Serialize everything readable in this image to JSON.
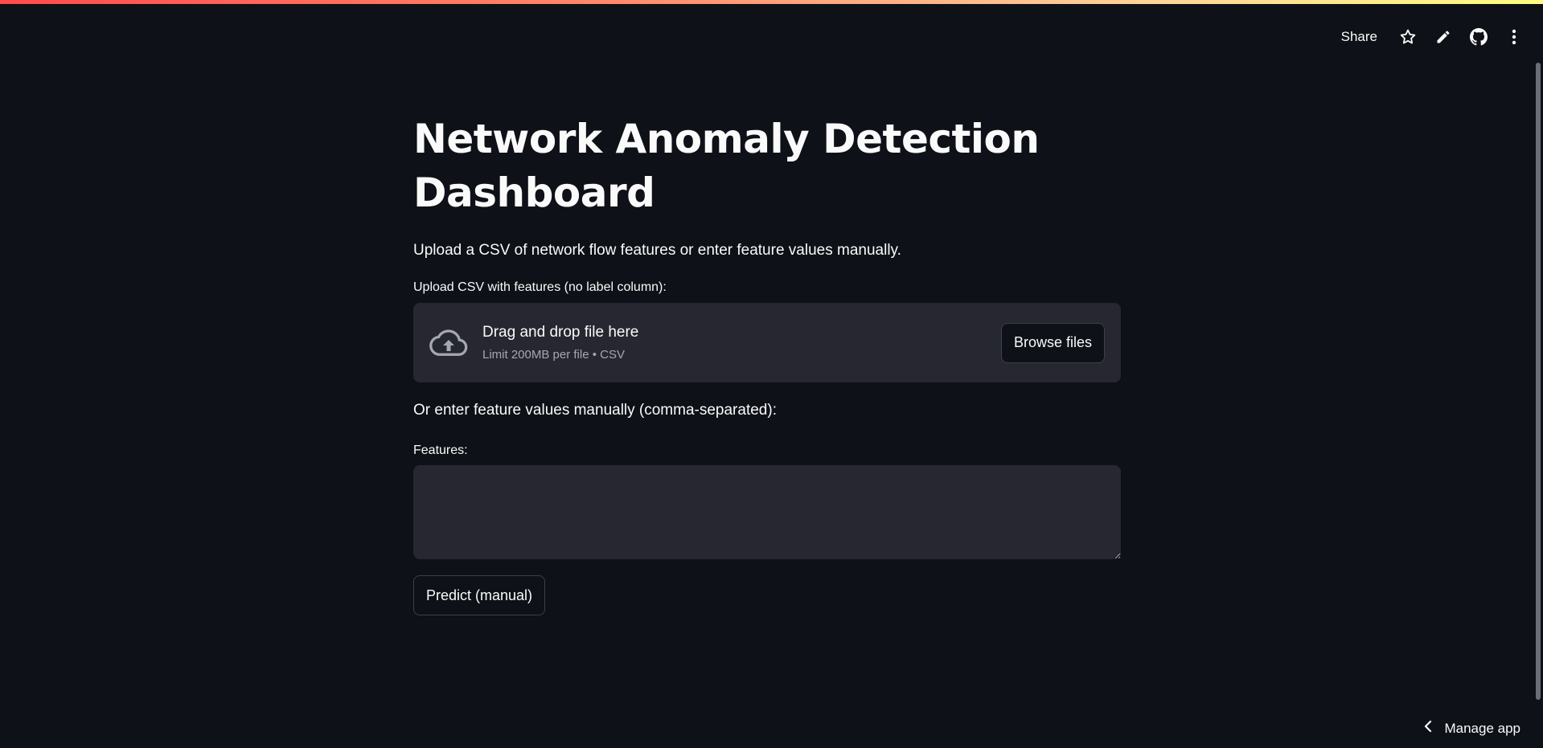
{
  "header": {
    "share_label": "Share",
    "icons": [
      "star-icon",
      "pencil-icon",
      "github-icon",
      "kebab-menu-icon"
    ]
  },
  "main": {
    "title": "Network Anomaly Detection Dashboard",
    "intro": "Upload a CSV of network flow features or enter feature values manually.",
    "uploader": {
      "label": "Upload CSV with features (no label column):",
      "drop_text": "Drag and drop file here",
      "limit_text": "Limit 200MB per file • CSV",
      "browse_label": "Browse files",
      "icon": "cloud-upload-icon"
    },
    "manual_text": "Or enter feature values manually (comma-separated):",
    "features": {
      "label": "Features:",
      "value": ""
    },
    "predict_label": "Predict (manual)"
  },
  "footer": {
    "manage_label": "Manage app",
    "icon": "chevron-left-icon"
  },
  "colors": {
    "background": "#0e1117",
    "widget_bg": "#262730",
    "text": "#fafafa",
    "muted": "#a3a8b4",
    "accent": "#ff4b4b"
  }
}
